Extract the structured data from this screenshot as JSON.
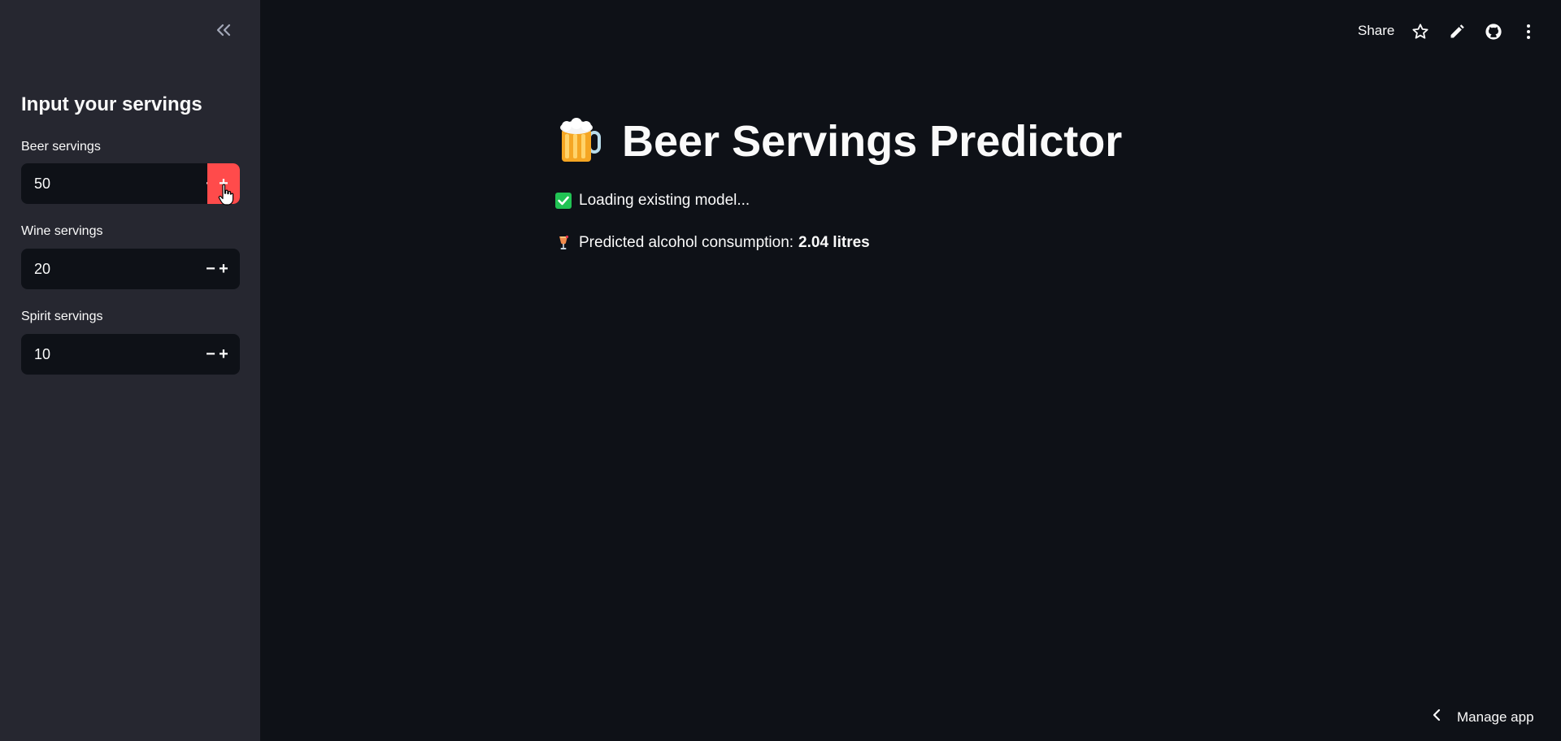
{
  "sidebar": {
    "title": "Input your servings",
    "collapse_icon": "double-chevron-left-icon",
    "inputs": [
      {
        "label": "Beer servings",
        "value": "50",
        "minus": "−",
        "plus": "+"
      },
      {
        "label": "Wine servings",
        "value": "20",
        "minus": "−",
        "plus": "+"
      },
      {
        "label": "Spirit servings",
        "value": "10",
        "minus": "−",
        "plus": "+"
      }
    ]
  },
  "toolbar": {
    "share_label": "Share",
    "icons": [
      "star-icon",
      "pencil-icon",
      "github-icon",
      "more-vertical-icon"
    ]
  },
  "main": {
    "title": "Beer Servings Predictor",
    "title_icon": "beer-mug-icon",
    "status": {
      "icon": "check-box-icon",
      "text": "Loading existing model..."
    },
    "prediction": {
      "icon": "cocktail-icon",
      "text": "Predicted alcohol consumption:",
      "value": "2.04 litres"
    }
  },
  "footer": {
    "manage_label": "Manage app"
  },
  "colors": {
    "background": "#0e1117",
    "sidebar": "#262730",
    "accent": "#ff4b4b",
    "check": "#21c354"
  }
}
